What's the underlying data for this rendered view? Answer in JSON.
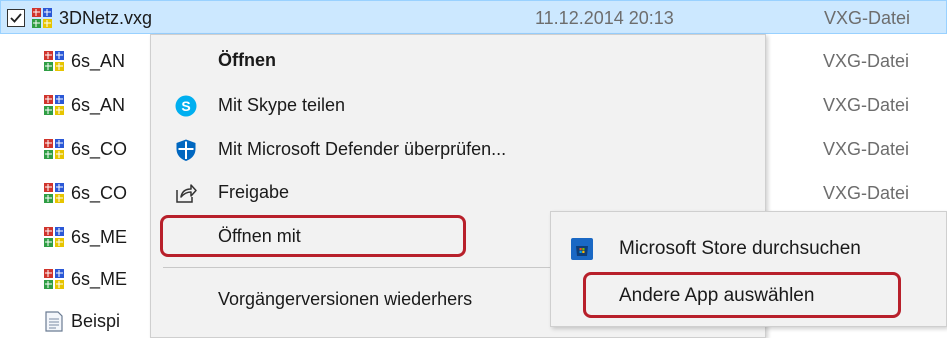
{
  "file_list": {
    "rows": [
      {
        "name": "3DNetz.vxg",
        "date": "11.12.2014 20:13",
        "type": "VXG-Datei"
      },
      {
        "name": "6s_AN",
        "type": "VXG-Datei"
      },
      {
        "name": "6s_AN",
        "type": "VXG-Datei"
      },
      {
        "name": "6s_CO",
        "type": "VXG-Datei"
      },
      {
        "name": "6s_CO",
        "type": "VXG-Datei"
      },
      {
        "name": "6s_ME"
      },
      {
        "name": "6s_ME"
      },
      {
        "name": "Beispi"
      }
    ],
    "icons": {
      "vxg": "vxg-file-icon",
      "txt": "text-file-icon"
    }
  },
  "context_menu": {
    "items": [
      {
        "label": "Öffnen",
        "icon": null
      },
      {
        "label": "Mit Skype teilen",
        "icon": "skype-icon"
      },
      {
        "label": "Mit Microsoft Defender überprüfen...",
        "icon": "defender-shield-icon"
      },
      {
        "label": "Freigabe",
        "icon": "share-icon"
      },
      {
        "label": "Öffnen mit",
        "icon": null
      },
      {
        "label": "Vorgängerversionen wiederhers",
        "icon": null
      }
    ]
  },
  "submenu": {
    "items": [
      {
        "label": "Microsoft Store durchsuchen",
        "icon": "microsoft-store-icon"
      },
      {
        "label": "Andere App auswählen",
        "icon": null
      }
    ]
  },
  "colors": {
    "selection": "#cce8ff",
    "highlight_border": "#b8202b",
    "menu_bg": "#f2f2f2",
    "muted_text": "#6d6d6d",
    "skype_blue": "#00aff0",
    "defender_blue": "#0067c0"
  }
}
